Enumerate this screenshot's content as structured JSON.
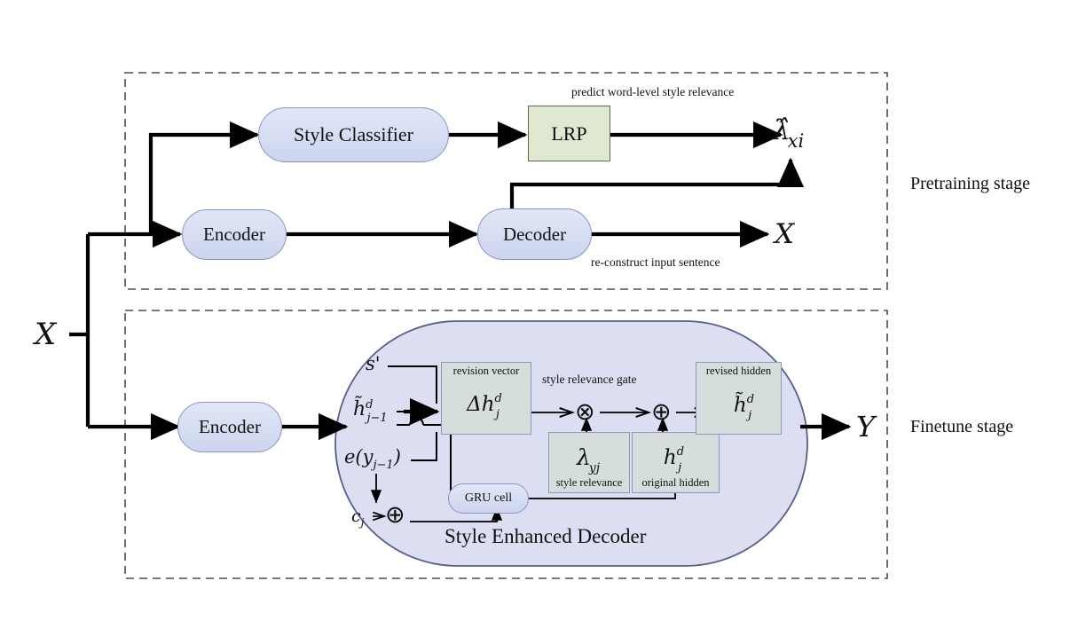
{
  "figure": {
    "type": "architecture-diagram",
    "title": "Style transfer model: pretraining and finetune stages"
  },
  "stages": {
    "pretraining": {
      "label": "Pretraining stage",
      "annotations": {
        "top": "predict word-level style relevance",
        "bottom": "re-construct input sentence"
      },
      "modules": {
        "style_classifier": "Style Classifier",
        "lrp": "LRP",
        "encoder": "Encoder",
        "decoder": "Decoder"
      },
      "outputs": {
        "relevance": "λ̂",
        "relevance_sub": "xi",
        "reconstruction": "X"
      }
    },
    "finetune": {
      "label": "Finetune stage",
      "modules": {
        "encoder": "Encoder",
        "gru_cell": "GRU cell"
      },
      "decoder_title": "Style Enhanced Decoder",
      "gate_label": "style relevance gate",
      "inputs": {
        "style": "s'",
        "prev_hidden_main": "h̃",
        "prev_hidden_sup": "d",
        "prev_hidden_sub": "j−1",
        "embedding": "e(y",
        "embedding_sub": "j−1",
        "embedding_tail": ")",
        "context": "c",
        "context_sub": "j"
      },
      "boxes": [
        {
          "name": "revision-vector",
          "caption_top": "revision vector",
          "symbol_main": "Δh",
          "symbol_sup": "d",
          "symbol_sub": "j",
          "caption_bottom": ""
        },
        {
          "name": "style-relevance",
          "caption_top": "",
          "symbol_main": "λ",
          "symbol_sup": "",
          "symbol_sub": "yj",
          "caption_bottom": "style relevance"
        },
        {
          "name": "original-hidden",
          "caption_top": "",
          "symbol_main": "h",
          "symbol_sup": "d",
          "symbol_sub": "j",
          "caption_bottom": "original hidden"
        },
        {
          "name": "revised-hidden",
          "caption_top": "revised hidden",
          "symbol_main": "h̃",
          "symbol_sup": "d",
          "symbol_sub": "j",
          "caption_bottom": ""
        }
      ],
      "operators": {
        "multiply": "⊗",
        "add_gate": "⊕",
        "add_context": "⊕"
      },
      "output": "Y"
    }
  },
  "global_input": "X",
  "colors": {
    "module_fill": "#d5dcf0",
    "module_border": "#8a93c4",
    "lrp_fill": "#dfe8d1",
    "lrp_border": "#5c6b4a",
    "inner_box_fill": "#d5dedc",
    "inner_box_border": "#8f99b8",
    "ellipse_fill": "#dcdff2",
    "ellipse_border": "#555e8d",
    "dashed_border": "#4a4a5e",
    "arrow": "#000000",
    "background": "#ffffff"
  }
}
